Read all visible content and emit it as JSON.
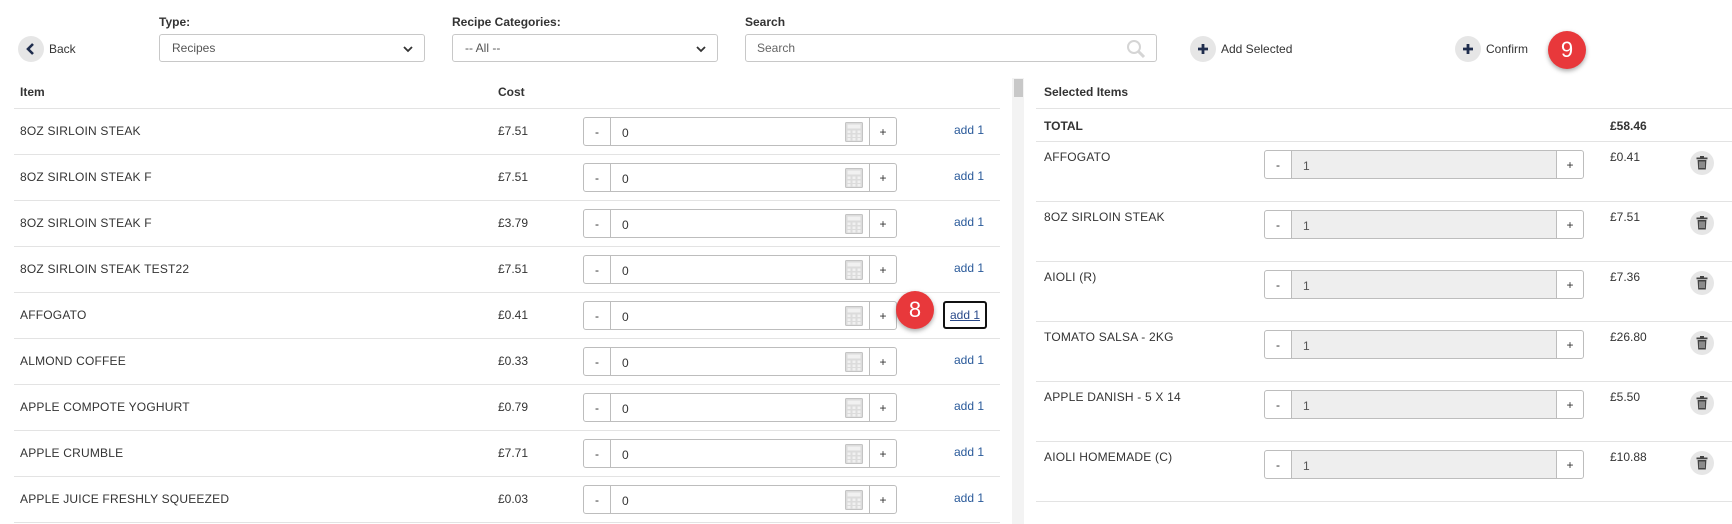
{
  "toolbar": {
    "back_label": "Back",
    "type_label": "Type:",
    "type_value": "Recipes",
    "categories_label": "Recipe Categories:",
    "categories_value": "-- All --",
    "search_label": "Search",
    "search_placeholder": "Search",
    "add_selected_label": "Add Selected",
    "confirm_label": "Confirm"
  },
  "badges": {
    "confirm_step": "9",
    "add_step": "8"
  },
  "left_table": {
    "headers": {
      "item": "Item",
      "cost": "Cost"
    },
    "qty_minus": "-",
    "qty_plus": "+",
    "rows": [
      {
        "name": "8OZ SIRLOIN STEAK",
        "cost": "£7.51",
        "qty": "0",
        "add": "add 1"
      },
      {
        "name": "8OZ SIRLOIN STEAK F",
        "cost": "£7.51",
        "qty": "0",
        "add": "add 1"
      },
      {
        "name": "8OZ SIRLOIN STEAK F",
        "cost": "£3.79",
        "qty": "0",
        "add": "add 1"
      },
      {
        "name": "8OZ SIRLOIN STEAK TEST22",
        "cost": "£7.51",
        "qty": "0",
        "add": "add 1"
      },
      {
        "name": "AFFOGATO",
        "cost": "£0.41",
        "qty": "0",
        "add": "add 1"
      },
      {
        "name": "ALMOND COFFEE",
        "cost": "£0.33",
        "qty": "0",
        "add": "add 1"
      },
      {
        "name": "APPLE COMPOTE YOGHURT",
        "cost": "£0.79",
        "qty": "0",
        "add": "add 1"
      },
      {
        "name": "APPLE CRUMBLE",
        "cost": "£7.71",
        "qty": "0",
        "add": "add 1"
      },
      {
        "name": "APPLE JUICE FRESHLY SQUEEZED",
        "cost": "£0.03",
        "qty": "0",
        "add": "add 1"
      }
    ]
  },
  "selected": {
    "header": "Selected Items",
    "total_label": "TOTAL",
    "total_value": "£58.46",
    "qty_minus": "-",
    "qty_plus": "+",
    "items": [
      {
        "name": "AFFOGATO",
        "qty": "1",
        "price": "£0.41"
      },
      {
        "name": "8OZ SIRLOIN STEAK",
        "qty": "1",
        "price": "£7.51"
      },
      {
        "name": "AIOLI (R)",
        "qty": "1",
        "price": "£7.36"
      },
      {
        "name": "TOMATO SALSA - 2KG",
        "qty": "1",
        "price": "£26.80"
      },
      {
        "name": "APPLE DANISH - 5 X 14",
        "qty": "1",
        "price": "£5.50"
      },
      {
        "name": "AIOLI HOMEMADE (C)",
        "qty": "1",
        "price": "£10.88"
      }
    ]
  },
  "colors": {
    "badge": "#e8383b",
    "link": "#2a5a9a",
    "icon_dark": "#1f2d4d"
  }
}
